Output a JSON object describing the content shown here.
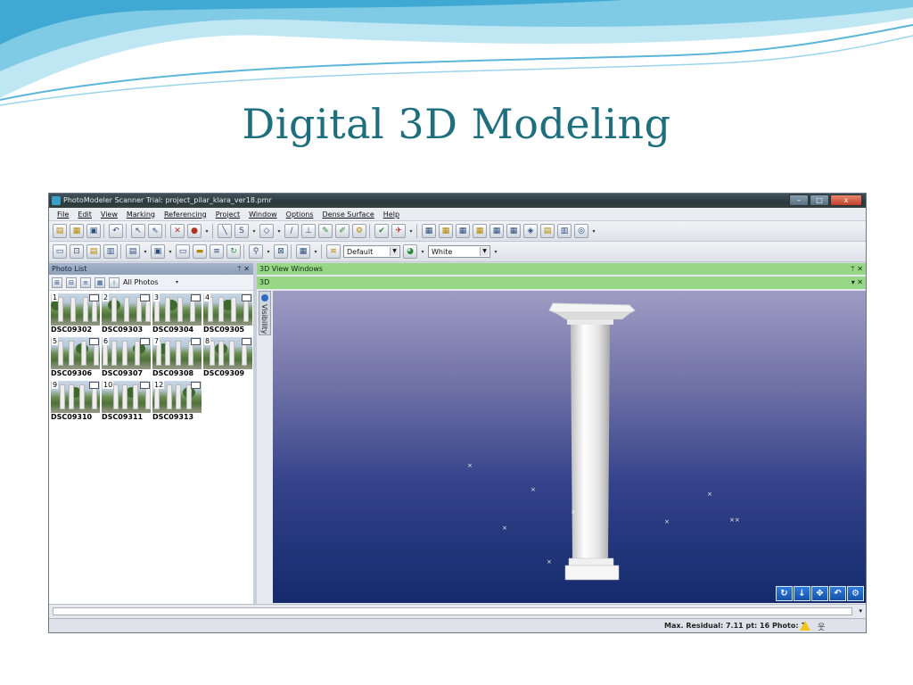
{
  "slide": {
    "title": "Digital 3D Modeling"
  },
  "window": {
    "title": "PhotoModeler Scanner Trial: project_pilar_klara_ver18.pmr",
    "controls": {
      "minimize": "–",
      "maximize": "□",
      "close": "x"
    }
  },
  "menu": [
    "File",
    "Edit",
    "View",
    "Marking",
    "Referencing",
    "Project",
    "Window",
    "Options",
    "Dense Surface",
    "Help"
  ],
  "toolbar2": {
    "preset_value": "Default",
    "color_value": "White"
  },
  "photo_list": {
    "header": "Photo List",
    "filter_value": "All Photos",
    "photos": [
      {
        "number": "1",
        "name": "DSC09302"
      },
      {
        "number": "2",
        "name": "DSC09303"
      },
      {
        "number": "3",
        "name": "DSC09304"
      },
      {
        "number": "4",
        "name": "DSC09305"
      },
      {
        "number": "5",
        "name": "DSC09306"
      },
      {
        "number": "6",
        "name": "DSC09307"
      },
      {
        "number": "7",
        "name": "DSC09308"
      },
      {
        "number": "8",
        "name": "DSC09309"
      },
      {
        "number": "9",
        "name": "DSC09310"
      },
      {
        "number": "10",
        "name": "DSC09311"
      },
      {
        "number": "12",
        "name": "DSC09313"
      }
    ]
  },
  "view_windows": {
    "header": "3D View Windows",
    "tab": "3D",
    "side_tab": "Visibility"
  },
  "status": {
    "text": "Max. Residual: 7.11 pt: 16 Photo: 1"
  },
  "colors": {
    "slide_title": "#1f6e7e",
    "panel_header_green": "#97d786",
    "viewport_bottom": "#142a6c"
  }
}
